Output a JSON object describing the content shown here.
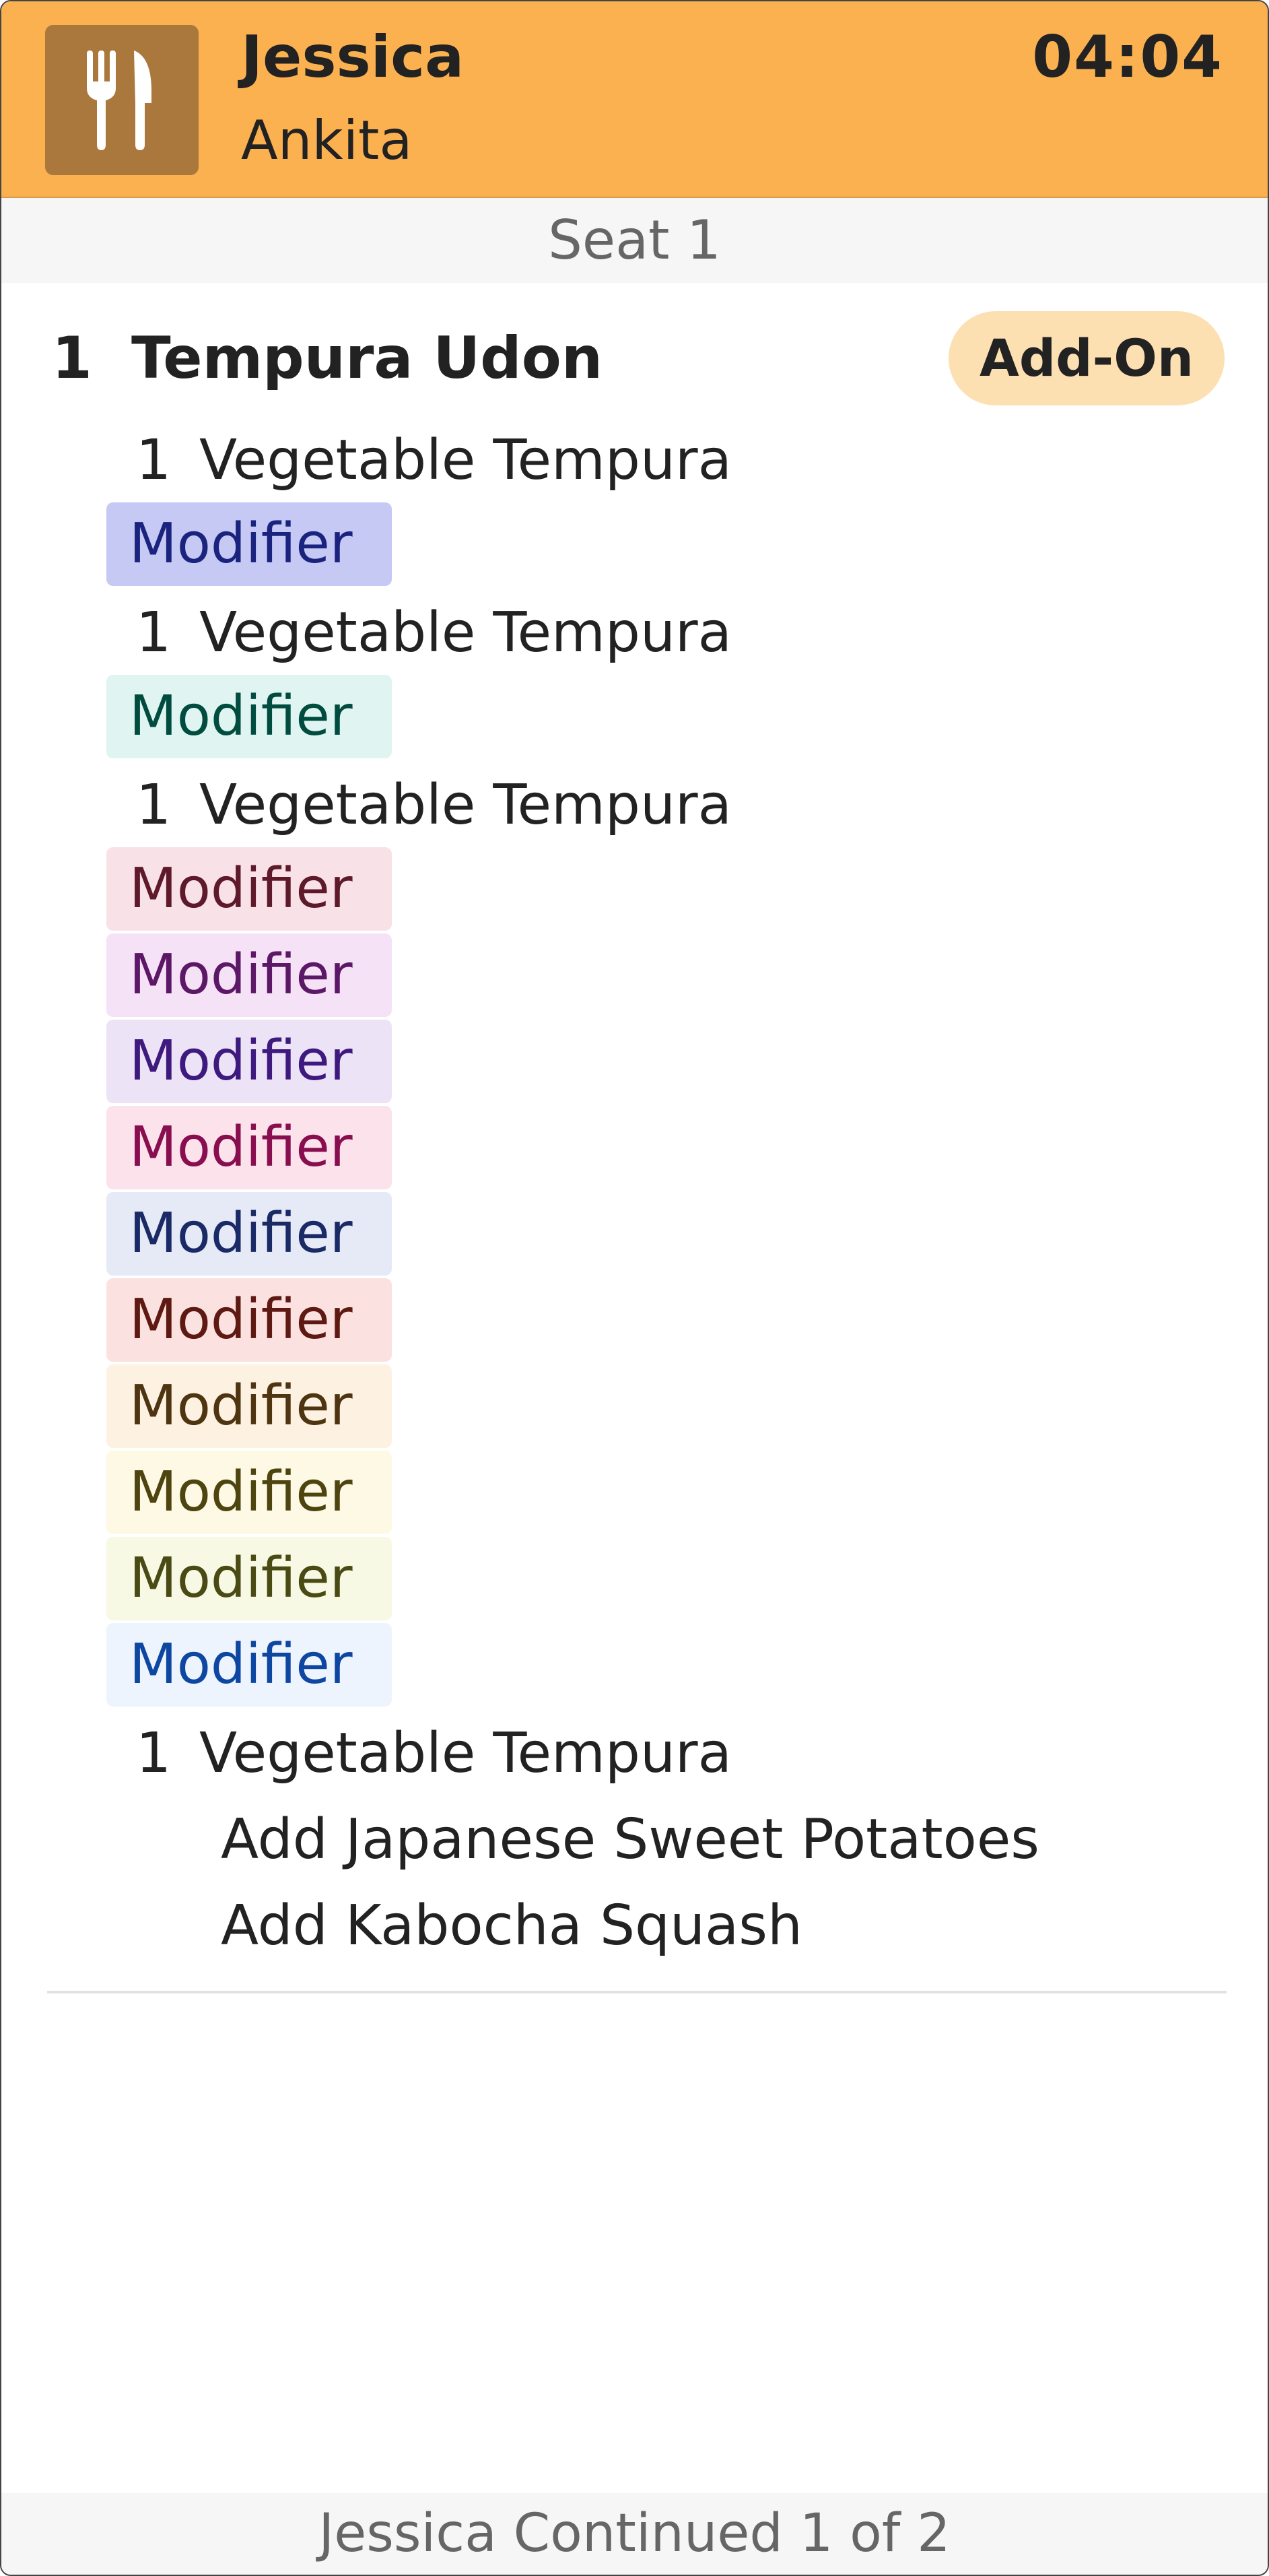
{
  "header": {
    "icon": "fork-knife-icon",
    "server_name": "Jessica",
    "guest_name": "Ankita",
    "timer": "04:04",
    "color": "#fcb150"
  },
  "seat": {
    "label": "Seat 1"
  },
  "item": {
    "qty": "1",
    "name": "Tempura Udon",
    "badge": "Add-On",
    "lines": [
      {
        "qty": "1",
        "name": "Vegetable Tempura"
      },
      {
        "qty": "1",
        "name": "Vegetable Tempura"
      },
      {
        "qty": "1",
        "name": "Vegetable Tempura"
      },
      {
        "qty": "1",
        "name": "Vegetable Tempura"
      }
    ],
    "modifiers": [
      {
        "label": "Modifier",
        "bg": "#c5c9f4",
        "fg": "#1a237e"
      },
      {
        "label": "Modifier",
        "bg": "#e0f4f1",
        "fg": "#004d40"
      },
      {
        "label": "Modifier",
        "bg": "#f8e2e8",
        "fg": "#5e1a2a"
      },
      {
        "label": "Modifier",
        "bg": "#f6e2f6",
        "fg": "#5c1766"
      },
      {
        "label": "Modifier",
        "bg": "#ece4f6",
        "fg": "#3f1a7e"
      },
      {
        "label": "Modifier",
        "bg": "#fce2ea",
        "fg": "#880e4f"
      },
      {
        "label": "Modifier",
        "bg": "#e6eaf6",
        "fg": "#1a2a66"
      },
      {
        "label": "Modifier",
        "bg": "#fbe2e0",
        "fg": "#5e1a12"
      },
      {
        "label": "Modifier",
        "bg": "#fdf2e2",
        "fg": "#4e3410"
      },
      {
        "label": "Modifier",
        "bg": "#fdf9e4",
        "fg": "#4e4410"
      },
      {
        "label": "Modifier",
        "bg": "#f8f9e4",
        "fg": "#4a4a14"
      },
      {
        "label": "Modifier",
        "bg": "#eef4fd",
        "fg": "#0d47a1"
      }
    ],
    "sub_lines": [
      "Add Japanese Sweet Potatoes",
      "Add Kabocha Squash"
    ]
  },
  "footer": {
    "label": "Jessica Continued 1 of 2"
  }
}
